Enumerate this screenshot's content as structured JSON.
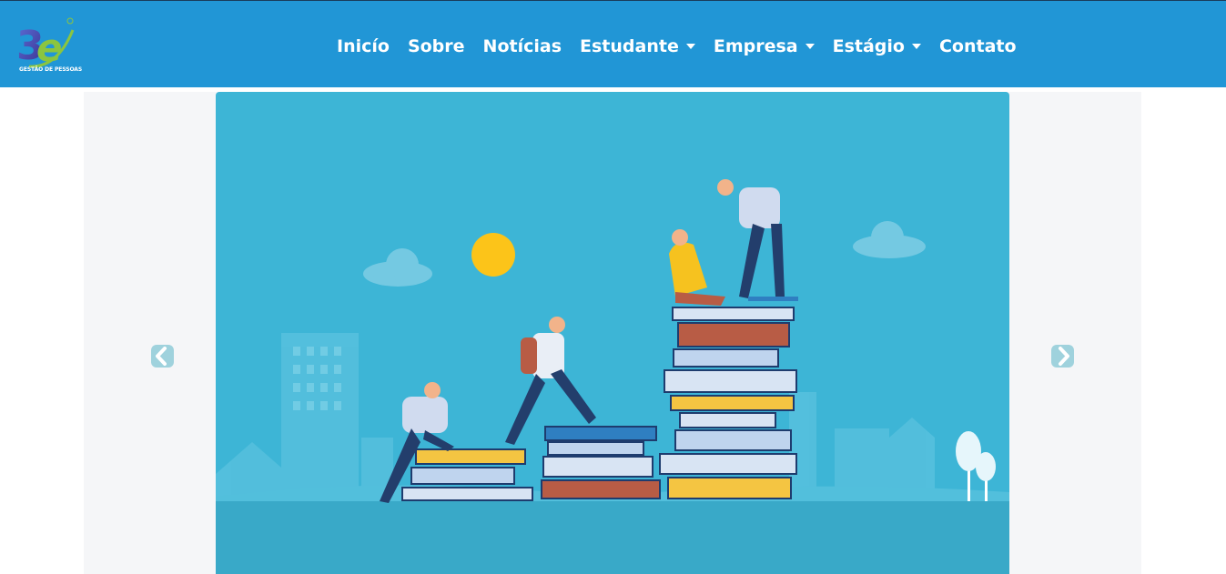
{
  "brand": {
    "logo_text": "3e",
    "caption": "GESTÃO DE PESSOAS",
    "colors": {
      "navy": "#2b3a8f",
      "green": "#8bc53f"
    }
  },
  "nav": {
    "items": [
      {
        "label": "Inicío",
        "dropdown": false
      },
      {
        "label": "Sobre",
        "dropdown": false
      },
      {
        "label": "Notícias",
        "dropdown": false
      },
      {
        "label": "Estudante",
        "dropdown": true
      },
      {
        "label": "Empresa",
        "dropdown": true
      },
      {
        "label": "Estágio",
        "dropdown": true
      },
      {
        "label": "Contato",
        "dropdown": false
      }
    ]
  },
  "carousel": {
    "prev_icon": "chevron-left-icon",
    "next_icon": "chevron-right-icon",
    "slide_description": "people-climbing-stacks-of-books-illustration"
  },
  "colors": {
    "header": "#2196d6",
    "slide_sky": "#3db5d6",
    "slide_ground": "#39a9c8",
    "sun": "#fcc419"
  }
}
